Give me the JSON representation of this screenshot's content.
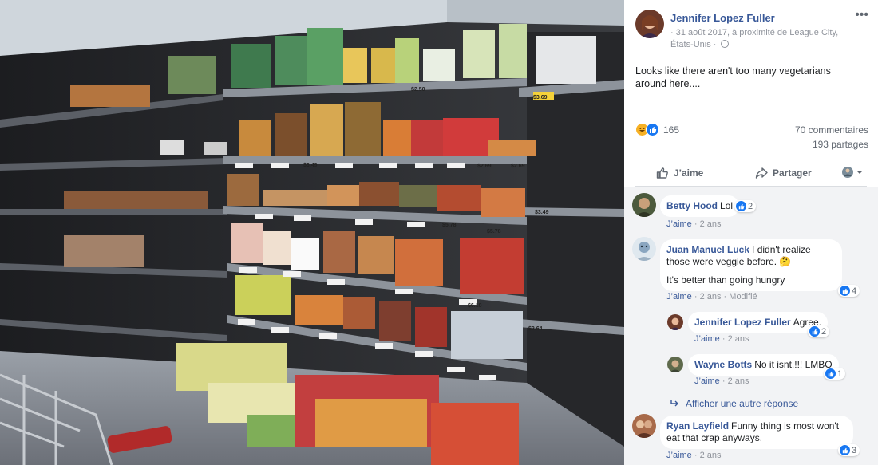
{
  "post": {
    "author": "Jennifer Lopez Fuller",
    "meta": "· 31 août 2017, à proximité de League City, États-Unis ·",
    "text": "Looks like there aren't too many vegetarians around here....",
    "reactions_count": "165",
    "comments_count": "70 commentaires",
    "shares_count": "193 partages"
  },
  "actions": {
    "like": "J’aime",
    "share": "Partager"
  },
  "price_tags": [
    "$2.69",
    "$3.49",
    "$5.78",
    "$5.78",
    "$3.49",
    "$2.69",
    "$6.18",
    "$2.64",
    "$3.69",
    "$2.50"
  ],
  "comments": [
    {
      "author": "Betty Hood",
      "text": "Lol",
      "like": "J’aime",
      "time": "2 ans",
      "reactions": "2"
    },
    {
      "author": "Juan Manuel Luck",
      "text": "I didn't realize those were veggie before. 🤔",
      "text2": "It's better than going hungry",
      "like": "J’aime",
      "time": "2 ans",
      "edited": "Modifié",
      "reactions": "4"
    },
    {
      "author": "Jennifer Lopez Fuller",
      "text": "Agree.",
      "like": "J’aime",
      "time": "2 ans",
      "reactions": "2"
    },
    {
      "author": "Wayne Botts",
      "text": "No it isnt.!!! LMBO",
      "like": "J’aime",
      "time": "2 ans",
      "reactions": "1"
    },
    {
      "author": "Ryan Layfield",
      "text": "Funny thing is most won't eat that crap anyways.",
      "like": "J’aime",
      "time": "2 ans",
      "reactions": "3"
    }
  ],
  "more_replies": "Afficher une autre réponse",
  "colors": {
    "link": "#385898",
    "accent": "#1877f2",
    "muted": "#90949c"
  },
  "icons": [
    "globe-icon",
    "more-options-icon",
    "haha-reaction-icon",
    "like-reaction-icon",
    "thumbs-up-icon",
    "share-arrow-icon",
    "audience-selector-icon",
    "reply-arrow-icon"
  ]
}
